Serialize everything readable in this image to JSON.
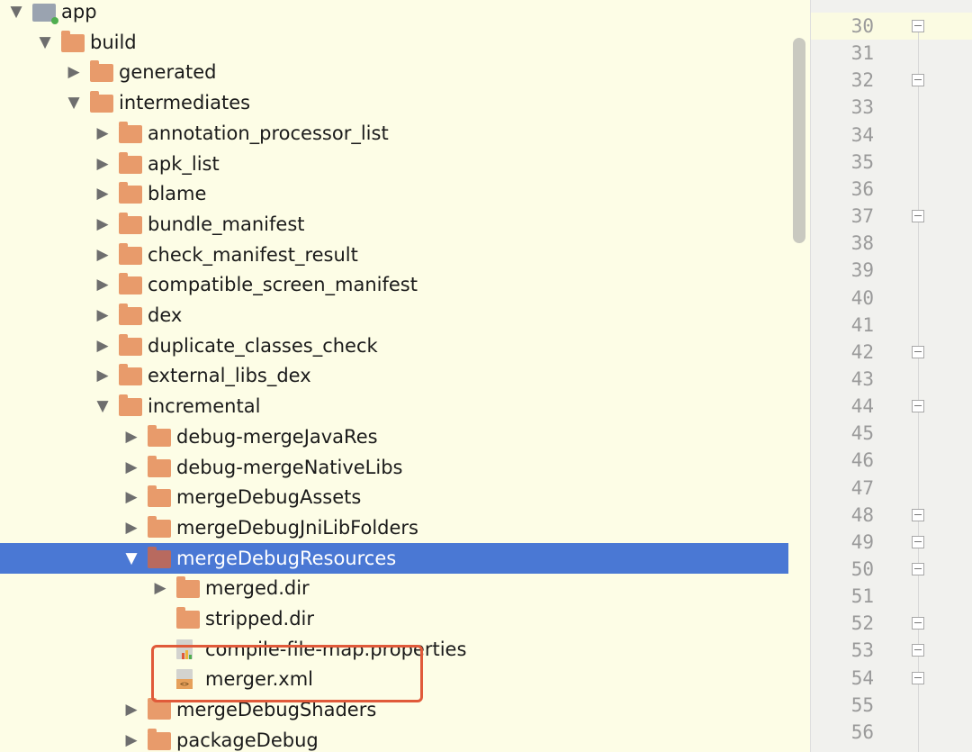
{
  "tree": {
    "rows": [
      {
        "label": "app",
        "icon": "module-icon",
        "expanded": true,
        "level": 0
      },
      {
        "label": "build",
        "icon": "folder-icon",
        "expanded": true,
        "level": 1
      },
      {
        "label": "generated",
        "icon": "folder-icon",
        "expanded": false,
        "level": 2
      },
      {
        "label": "intermediates",
        "icon": "folder-icon",
        "expanded": true,
        "level": 2
      },
      {
        "label": "annotation_processor_list",
        "icon": "folder-icon",
        "expanded": false,
        "level": 3
      },
      {
        "label": "apk_list",
        "icon": "folder-icon",
        "expanded": false,
        "level": 3
      },
      {
        "label": "blame",
        "icon": "folder-icon",
        "expanded": false,
        "level": 3
      },
      {
        "label": "bundle_manifest",
        "icon": "folder-icon",
        "expanded": false,
        "level": 3
      },
      {
        "label": "check_manifest_result",
        "icon": "folder-icon",
        "expanded": false,
        "level": 3
      },
      {
        "label": "compatible_screen_manifest",
        "icon": "folder-icon",
        "expanded": false,
        "level": 3
      },
      {
        "label": "dex",
        "icon": "folder-icon",
        "expanded": false,
        "level": 3
      },
      {
        "label": "duplicate_classes_check",
        "icon": "folder-icon",
        "expanded": false,
        "level": 3
      },
      {
        "label": "external_libs_dex",
        "icon": "folder-icon",
        "expanded": false,
        "level": 3
      },
      {
        "label": "incremental",
        "icon": "folder-icon",
        "expanded": true,
        "level": 3
      },
      {
        "label": "debug-mergeJavaRes",
        "icon": "folder-icon",
        "expanded": false,
        "level": 4
      },
      {
        "label": "debug-mergeNativeLibs",
        "icon": "folder-icon",
        "expanded": false,
        "level": 4
      },
      {
        "label": "mergeDebugAssets",
        "icon": "folder-icon",
        "expanded": false,
        "level": 4
      },
      {
        "label": "mergeDebugJniLibFolders",
        "icon": "folder-icon",
        "expanded": false,
        "level": 4
      },
      {
        "label": "mergeDebugResources",
        "icon": "folder-icon",
        "expanded": true,
        "selected": true,
        "level": 4
      },
      {
        "label": "merged.dir",
        "icon": "folder-icon",
        "expanded": false,
        "level": 5
      },
      {
        "label": "stripped.dir",
        "icon": "folder-icon",
        "leaf": true,
        "level": 5
      },
      {
        "label": "compile-file-map.properties",
        "icon": "properties-file-icon",
        "leaf": true,
        "level": 5
      },
      {
        "label": "merger.xml",
        "icon": "xml-file-icon",
        "leaf": true,
        "level": 5
      },
      {
        "label": "mergeDebugShaders",
        "icon": "folder-icon",
        "expanded": false,
        "level": 4
      },
      {
        "label": "packageDebug",
        "icon": "folder-icon",
        "expanded": false,
        "level": 4
      }
    ]
  },
  "gutter": {
    "line_numbers": [
      "30",
      "31",
      "32",
      "33",
      "34",
      "35",
      "36",
      "37",
      "38",
      "39",
      "40",
      "41",
      "42",
      "43",
      "44",
      "45",
      "46",
      "47",
      "48",
      "49",
      "50",
      "51",
      "52",
      "53",
      "54",
      "55",
      "56"
    ],
    "fold_markers": [
      "30",
      "32",
      "37",
      "42",
      "44",
      "48",
      "49",
      "50",
      "52",
      "53",
      "54"
    ],
    "current_line": "30"
  },
  "colors": {
    "selection": "#4a78d4",
    "folder": "#e89b6b",
    "background": "#fdfde6",
    "highlight_box": "#e05a3a"
  }
}
